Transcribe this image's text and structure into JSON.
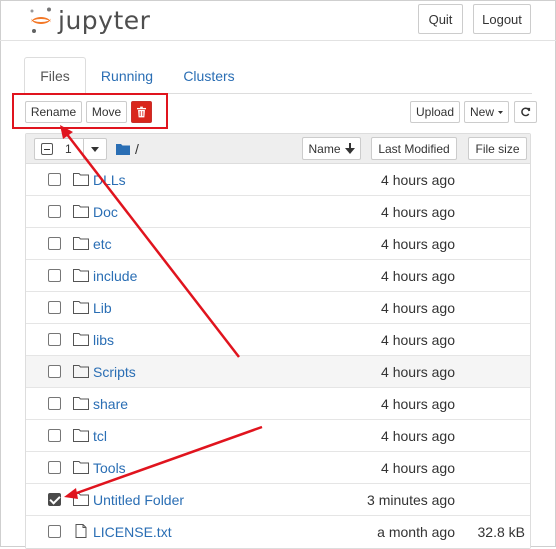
{
  "app": {
    "logo_text": "jupyter"
  },
  "header": {
    "quit_label": "Quit",
    "logout_label": "Logout"
  },
  "tabs": [
    {
      "label": "Files",
      "active": true
    },
    {
      "label": "Running",
      "active": false
    },
    {
      "label": "Clusters",
      "active": false
    }
  ],
  "toolbar": {
    "rename_label": "Rename",
    "move_label": "Move",
    "upload_label": "Upload",
    "new_label": "New"
  },
  "list_header": {
    "selected_count": "1",
    "path": "/",
    "name_label": "Name",
    "modified_label": "Last Modified",
    "size_label": "File size"
  },
  "rows": [
    {
      "name": "DLLs",
      "type": "folder",
      "modified": "4 hours ago",
      "size": "",
      "checked": false
    },
    {
      "name": "Doc",
      "type": "folder",
      "modified": "4 hours ago",
      "size": "",
      "checked": false
    },
    {
      "name": "etc",
      "type": "folder",
      "modified": "4 hours ago",
      "size": "",
      "checked": false
    },
    {
      "name": "include",
      "type": "folder",
      "modified": "4 hours ago",
      "size": "",
      "checked": false
    },
    {
      "name": "Lib",
      "type": "folder",
      "modified": "4 hours ago",
      "size": "",
      "checked": false
    },
    {
      "name": "libs",
      "type": "folder",
      "modified": "4 hours ago",
      "size": "",
      "checked": false
    },
    {
      "name": "Scripts",
      "type": "folder",
      "modified": "4 hours ago",
      "size": "",
      "checked": false
    },
    {
      "name": "share",
      "type": "folder",
      "modified": "4 hours ago",
      "size": "",
      "checked": false
    },
    {
      "name": "tcl",
      "type": "folder",
      "modified": "4 hours ago",
      "size": "",
      "checked": false
    },
    {
      "name": "Tools",
      "type": "folder",
      "modified": "4 hours ago",
      "size": "",
      "checked": false
    },
    {
      "name": "Untitled Folder",
      "type": "folder",
      "modified": "3 minutes ago",
      "size": "",
      "checked": true
    },
    {
      "name": "LICENSE.txt",
      "type": "file",
      "modified": "a month ago",
      "size": "32.8 kB",
      "checked": false
    }
  ],
  "colors": {
    "link": "#2a6eb4",
    "annotation_red": "#e0141e",
    "delete_red": "#d9261c",
    "jupyter_orange": "#f37726"
  },
  "icons": {
    "delete": "trash-icon",
    "refresh": "refresh-icon",
    "folder": "folder-icon",
    "file": "file-icon",
    "sort": "arrow-down-icon",
    "dropdown": "caret-down-icon"
  }
}
